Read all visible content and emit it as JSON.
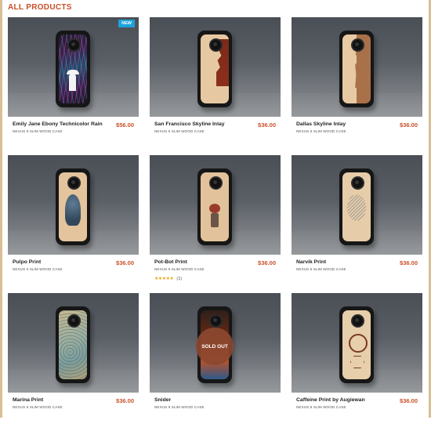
{
  "section_title": "ALL PRODUCTS",
  "badge_new_label": "NEW",
  "sold_out_label": "SOLD OUT",
  "products": [
    {
      "name": "Emily Jane Ebony Technicolor Rain",
      "price": "$56.00",
      "subtitle": "NEXUS 6 SLIM WOOD CASE",
      "badge": "NEW"
    },
    {
      "name": "San Francisco Skyline Inlay",
      "price": "$36.00",
      "subtitle": "NEXUS 6 SLIM WOOD CASE"
    },
    {
      "name": "Dallas Skyline Inlay",
      "price": "$36.00",
      "subtitle": "NEXUS 6 SLIM WOOD CASE"
    },
    {
      "name": "Pulpo Print",
      "price": "$36.00",
      "subtitle": "NEXUS 6 SLIM WOOD CASE"
    },
    {
      "name": "Pot-Bot Print",
      "price": "$36.00",
      "subtitle": "NEXUS 6 SLIM WOOD CASE",
      "rating": {
        "stars": "★★★★★",
        "count": "(1)",
        "value": 5
      }
    },
    {
      "name": "Narvik Print",
      "price": "$36.00",
      "subtitle": "NEXUS 6 SLIM WOOD CASE"
    },
    {
      "name": "Marina Print",
      "price": "$36.00",
      "subtitle": "NEXUS 6 SLIM WOOD CASE"
    },
    {
      "name": "Snider",
      "price": "",
      "subtitle": "NEXUS 6 SLIM WOOD CASE",
      "status": "SOLD OUT"
    },
    {
      "name": "Caffeine Print by Augiewan",
      "price": "$36.00",
      "subtitle": "NEXUS 6 SLIM WOOD CASE"
    }
  ],
  "colors": {
    "accent": "#c8502a",
    "badge_new": "#1ca3dc",
    "sold_out": "#8c4830",
    "star": "#e6a817",
    "frame": "#d9bf94"
  }
}
